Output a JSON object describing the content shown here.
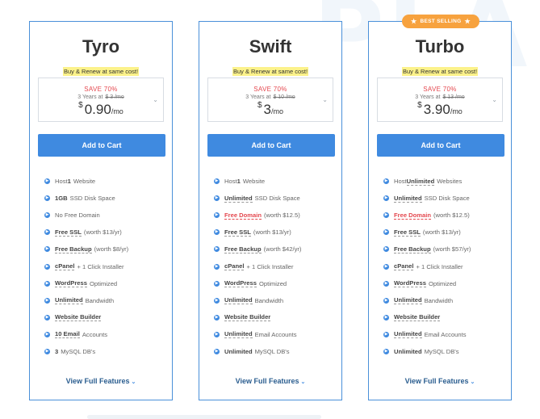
{
  "colors": {
    "accent": "#3f8ae0",
    "save_red": "#e4474e",
    "ribbon": "#f7a23e",
    "highlight": "#fcf28a"
  },
  "plans": [
    {
      "name": "Tyro",
      "badge": "",
      "tagline": "Buy & Renew at same cost!",
      "save": "SAVE 70%",
      "term": "3 Years at",
      "old_price": "$ 3 /mo",
      "currency": "$",
      "price": "0.90",
      "per": "/mo",
      "cart": "Add to Cart",
      "link": "View Full Features",
      "features": [
        {
          "pre": "Host ",
          "hl": "1",
          "post": " Website",
          "style": "plain"
        },
        {
          "pre": "",
          "hl": "1GB",
          "post": " SSD Disk Space",
          "style": "plain"
        },
        {
          "pre": "No Free Domain",
          "hl": "",
          "post": "",
          "style": "plain"
        },
        {
          "pre": "",
          "hl": "Free SSL",
          "post": " (worth $13/yr)",
          "style": "dash"
        },
        {
          "pre": "",
          "hl": "Free Backup",
          "post": " (worth $8/yr)",
          "style": "dash"
        },
        {
          "pre": "",
          "hl": "cPanel",
          "post": " + 1 Click Installer",
          "style": "dash"
        },
        {
          "pre": "",
          "hl": "WordPress",
          "post": " Optimized",
          "style": "dash"
        },
        {
          "pre": "",
          "hl": "Unlimited",
          "post": " Bandwidth",
          "style": "dash"
        },
        {
          "pre": "",
          "hl": "Website Builder",
          "post": "",
          "style": "dash"
        },
        {
          "pre": "",
          "hl": "10 Email",
          "post": " Accounts",
          "style": "dash"
        },
        {
          "pre": "",
          "hl": "3",
          "post": " MySQL DB's",
          "style": "plain"
        }
      ]
    },
    {
      "name": "Swift",
      "badge": "",
      "tagline": "Buy & Renew at same cost!",
      "save": "SAVE 70%",
      "term": "3 Years at",
      "old_price": "$ 10 /mo",
      "currency": "$",
      "price": "3",
      "per": "/mo",
      "cart": "Add to Cart",
      "link": "View Full Features",
      "features": [
        {
          "pre": "Host ",
          "hl": "1",
          "post": " Website",
          "style": "plain"
        },
        {
          "pre": "",
          "hl": "Unlimited",
          "post": " SSD Disk Space",
          "style": "dash"
        },
        {
          "pre": "",
          "hl": "Free Domain",
          "post": " (worth $12.5)",
          "style": "red"
        },
        {
          "pre": "",
          "hl": "Free SSL",
          "post": " (worth $13/yr)",
          "style": "dash"
        },
        {
          "pre": "",
          "hl": "Free Backup",
          "post": " (worth $42/yr)",
          "style": "dash"
        },
        {
          "pre": "",
          "hl": "cPanel",
          "post": " + 1 Click Installer",
          "style": "dash"
        },
        {
          "pre": "",
          "hl": "WordPress",
          "post": " Optimized",
          "style": "dash"
        },
        {
          "pre": "",
          "hl": "Unlimited",
          "post": " Bandwidth",
          "style": "dash"
        },
        {
          "pre": "",
          "hl": "Website Builder",
          "post": "",
          "style": "dash"
        },
        {
          "pre": "",
          "hl": "Unlimited",
          "post": " Email Accounts",
          "style": "dash"
        },
        {
          "pre": "",
          "hl": "Unlimited",
          "post": " MySQL DB's",
          "style": "plain"
        }
      ]
    },
    {
      "name": "Turbo",
      "badge": "BEST SELLING",
      "tagline": "Buy & Renew at same cost!",
      "save": "SAVE 70%",
      "term": "3 Years at",
      "old_price": "$ 13 /mo",
      "currency": "$",
      "price": "3.90",
      "per": "/mo",
      "cart": "Add to Cart",
      "link": "View Full Features",
      "features": [
        {
          "pre": "Host ",
          "hl": "Unlimited",
          "post": " Websites",
          "style": "dash"
        },
        {
          "pre": "",
          "hl": "Unlimited",
          "post": " SSD Disk Space",
          "style": "dash"
        },
        {
          "pre": "",
          "hl": "Free Domain",
          "post": " (worth $12.5)",
          "style": "red"
        },
        {
          "pre": "",
          "hl": "Free SSL",
          "post": " (worth $13/yr)",
          "style": "dash"
        },
        {
          "pre": "",
          "hl": "Free Backup",
          "post": " (worth $57/yr)",
          "style": "dash"
        },
        {
          "pre": "",
          "hl": "cPanel",
          "post": " + 1 Click Installer",
          "style": "dash"
        },
        {
          "pre": "",
          "hl": "WordPress",
          "post": " Optimized",
          "style": "dash"
        },
        {
          "pre": "",
          "hl": "Unlimited",
          "post": " Bandwidth",
          "style": "dash"
        },
        {
          "pre": "",
          "hl": "Website Builder",
          "post": "",
          "style": "dash"
        },
        {
          "pre": "",
          "hl": "Unlimited",
          "post": " Email Accounts",
          "style": "dash"
        },
        {
          "pre": "",
          "hl": "Unlimited",
          "post": " MySQL DB's",
          "style": "plain"
        }
      ]
    }
  ]
}
